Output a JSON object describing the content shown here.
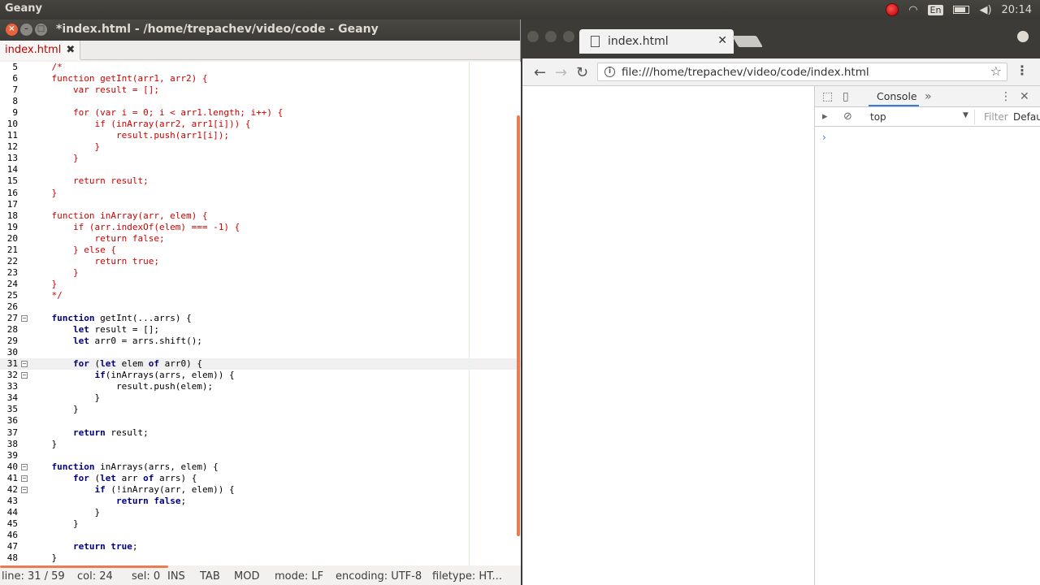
{
  "topbar": {
    "app_name": "Geany",
    "keyboard": "En",
    "clock": "20:14"
  },
  "geany": {
    "title": "*index.html - /home/trepachev/video/code - Geany",
    "tab_label": "index.html",
    "lines": [
      {
        "n": "5",
        "t": "    /*",
        "cls": "c"
      },
      {
        "n": "6",
        "t": "    function getInt(arr1, arr2) {",
        "cls": "c"
      },
      {
        "n": "7",
        "t": "        var result = [];",
        "cls": "c"
      },
      {
        "n": "8",
        "t": "",
        "cls": "c"
      },
      {
        "n": "9",
        "t": "        for (var i = 0; i < arr1.length; i++) {",
        "cls": "c"
      },
      {
        "n": "10",
        "t": "            if (inArray(arr2, arr1[i])) {",
        "cls": "c"
      },
      {
        "n": "11",
        "t": "                result.push(arr1[i]);",
        "cls": "c"
      },
      {
        "n": "12",
        "t": "            }",
        "cls": "c"
      },
      {
        "n": "13",
        "t": "        }",
        "cls": "c"
      },
      {
        "n": "14",
        "t": "",
        "cls": "c"
      },
      {
        "n": "15",
        "t": "        return result;",
        "cls": "c"
      },
      {
        "n": "16",
        "t": "    }",
        "cls": "c"
      },
      {
        "n": "17",
        "t": "",
        "cls": "c"
      },
      {
        "n": "18",
        "t": "    function inArray(arr, elem) {",
        "cls": "c"
      },
      {
        "n": "19",
        "t": "        if (arr.indexOf(elem) === -1) {",
        "cls": "c"
      },
      {
        "n": "20",
        "t": "            return false;",
        "cls": "c"
      },
      {
        "n": "21",
        "t": "        } else {",
        "cls": "c"
      },
      {
        "n": "22",
        "t": "            return true;",
        "cls": "c"
      },
      {
        "n": "23",
        "t": "        }",
        "cls": "c"
      },
      {
        "n": "24",
        "t": "    }",
        "cls": "c"
      },
      {
        "n": "25",
        "t": "    */",
        "cls": "c"
      },
      {
        "n": "26",
        "t": "",
        "cls": ""
      },
      {
        "n": "27",
        "t": "    <k>function</k> getInt(...arrs) {",
        "cls": "",
        "fold": true
      },
      {
        "n": "28",
        "t": "        <k>let</k> result = [];",
        "cls": ""
      },
      {
        "n": "29",
        "t": "        <k>let</k> arr0 = arrs.shift();",
        "cls": ""
      },
      {
        "n": "30",
        "t": "",
        "cls": ""
      },
      {
        "n": "31",
        "t": "        <k>for</k> (<k>let</k> elem <k>of</k> arr0) {",
        "cls": "",
        "fold": true,
        "cur": true
      },
      {
        "n": "32",
        "t": "            <k>if</k>(inArrays(arrs, elem)) {",
        "cls": "",
        "fold": true
      },
      {
        "n": "33",
        "t": "                result.push(elem);",
        "cls": ""
      },
      {
        "n": "34",
        "t": "            }",
        "cls": ""
      },
      {
        "n": "35",
        "t": "        }",
        "cls": ""
      },
      {
        "n": "36",
        "t": "",
        "cls": ""
      },
      {
        "n": "37",
        "t": "        <k>return</k> result;",
        "cls": ""
      },
      {
        "n": "38",
        "t": "    }",
        "cls": ""
      },
      {
        "n": "39",
        "t": "",
        "cls": ""
      },
      {
        "n": "40",
        "t": "    <k>function</k> inArrays(arrs, elem) {",
        "cls": "",
        "fold": true
      },
      {
        "n": "41",
        "t": "        <k>for</k> (<k>let</k> arr <k>of</k> arrs) {",
        "cls": "",
        "fold": true
      },
      {
        "n": "42",
        "t": "            <k>if</k> (!inArray(arr, elem)) {",
        "cls": "",
        "fold": true
      },
      {
        "n": "43",
        "t": "                <k>return</k> <k>false</k>;",
        "cls": ""
      },
      {
        "n": "44",
        "t": "            }",
        "cls": ""
      },
      {
        "n": "45",
        "t": "        }",
        "cls": ""
      },
      {
        "n": "46",
        "t": "",
        "cls": ""
      },
      {
        "n": "47",
        "t": "        <k>return</k> <k>true</k>;",
        "cls": ""
      },
      {
        "n": "48",
        "t": "    }",
        "cls": ""
      }
    ],
    "status": {
      "line": "line: 31 / 59",
      "col": "col: 24",
      "sel": "sel: 0",
      "ins": "INS",
      "tab": "TAB",
      "mod": "MOD",
      "mode": "mode: LF",
      "encoding": "encoding: UTF-8",
      "filetype": "filetype: HT..."
    }
  },
  "chrome": {
    "tab_title": "index.html",
    "url": "file:///home/trepachev/video/code/index.html",
    "devtools": {
      "panel": "Console",
      "context": "top",
      "filter_placeholder": "Filter",
      "levels": "Default",
      "prompt": "›"
    }
  },
  "icons": [
    "close-icon",
    "minimize-icon",
    "maximize-icon",
    "back-icon",
    "forward-icon",
    "reload-icon",
    "info-icon",
    "star-icon",
    "menu-icon",
    "inspect-icon",
    "device-icon",
    "more-tabs-icon",
    "close-devtools-icon",
    "sidebar-icon",
    "clear-icon",
    "profile-icon",
    "record-icon",
    "wifi-icon",
    "battery-icon",
    "volume-icon"
  ]
}
